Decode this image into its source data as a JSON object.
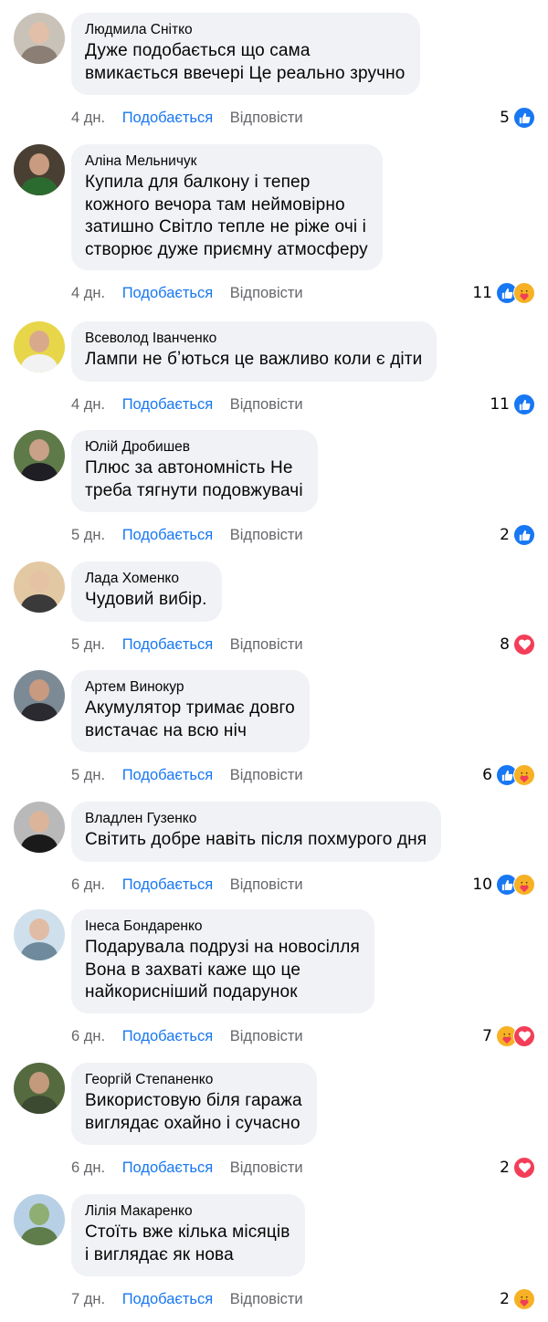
{
  "labels": {
    "like": "Подобається",
    "reply": "Відповісти"
  },
  "colors": {
    "bubble": "#f0f2f5",
    "link_blue": "#1877f2",
    "meta_gray": "#65676b",
    "like_blue": "#1877f2",
    "love_red": "#f33e58",
    "care_yellow": "#f7b125"
  },
  "comments": [
    {
      "author": "Людмила Снітко",
      "text": "Дуже подобається що сама\nвмикається ввечері Це реально зручно",
      "time": "4 дн.",
      "count": "5",
      "reactions": [
        "like-icon"
      ],
      "avatar": {
        "bg": "#c9c2b8",
        "face": "#e2bfa8",
        "body": "#8b7f75"
      }
    },
    {
      "author": "Аліна Мельничук",
      "text": "Купила для балкону і тепер\nкожного вечора там неймовірно\nзатишно Світло тепле не ріже очі і\nстворює дуже приємну атмосферу",
      "time": "4 дн.",
      "count": "11",
      "reactions": [
        "like-icon",
        "care-icon"
      ],
      "avatar": {
        "bg": "#4a3f33",
        "face": "#c99b80",
        "body": "#2b6b2f"
      }
    },
    {
      "author": "Всеволод Іванченко",
      "text": "Лампи не бʼються це важливо коли є діти",
      "time": "4 дн.",
      "count": "11",
      "reactions": [
        "like-icon"
      ],
      "avatar": {
        "bg": "#e8d64a",
        "face": "#d9a98c",
        "body": "#f2f2f2"
      }
    },
    {
      "author": "Юлій Дробишев",
      "text": "Плюс за автономність Не\nтреба тягнути подовжувачі",
      "time": "5 дн.",
      "count": "2",
      "reactions": [
        "like-icon"
      ],
      "avatar": {
        "bg": "#5e7a48",
        "face": "#c9a088",
        "body": "#1e1e24"
      }
    },
    {
      "author": "Лада Хоменко",
      "text": "Чудовий вибір.",
      "time": "5 дн.",
      "count": "8",
      "reactions": [
        "love-icon"
      ],
      "avatar": {
        "bg": "#e3c9a3",
        "face": "#e6c2a4",
        "body": "#3a3a3a"
      }
    },
    {
      "author": "Артем Винокур",
      "text": "Акумулятор тримає довго\nвистачає на всю ніч",
      "time": "5 дн.",
      "count": "6",
      "reactions": [
        "like-icon",
        "care-icon"
      ],
      "avatar": {
        "bg": "#7c8a96",
        "face": "#c89a80",
        "body": "#2a2a30"
      }
    },
    {
      "author": "Владлен Гузенко",
      "text": "Світить добре навіть після похмурого дня",
      "time": "6 дн.",
      "count": "10",
      "reactions": [
        "like-icon",
        "care-icon"
      ],
      "avatar": {
        "bg": "#b9b9b9",
        "face": "#dcb49a",
        "body": "#1a1a1a"
      }
    },
    {
      "author": "Інеса Бондаренко",
      "text": "Подарувала подрузі на новосілля\nВона в захваті каже що це\nнайкорисніший подарунок",
      "time": "6 дн.",
      "count": "7",
      "reactions": [
        "care-icon",
        "love-icon"
      ],
      "avatar": {
        "bg": "#cfe0ec",
        "face": "#e1bca5",
        "body": "#6f8a9c"
      }
    },
    {
      "author": "Георгій Степаненко",
      "text": "Використовую біля гаража\nвиглядає охайно і сучасно",
      "time": "6 дн.",
      "count": "2",
      "reactions": [
        "love-icon"
      ],
      "avatar": {
        "bg": "#556b3f",
        "face": "#c39a7c",
        "body": "#3c4a32"
      }
    },
    {
      "author": "Лілія Макаренко",
      "text": "Стоїть вже кілька місяців\nі виглядає як нова",
      "time": "7 дн.",
      "count": "2",
      "reactions": [
        "care-icon"
      ],
      "avatar": {
        "bg": "#b8d0e6",
        "face": "#8fae72",
        "body": "#5f7d4a"
      }
    }
  ]
}
